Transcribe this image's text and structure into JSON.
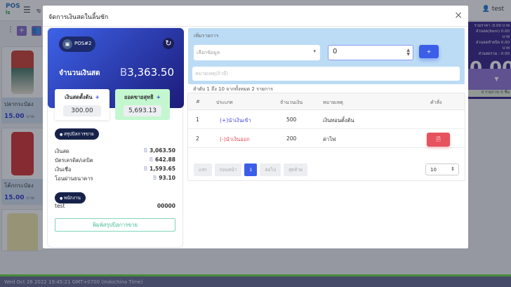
{
  "app": {
    "logo_top": "POS",
    "logo_bottom": "ls",
    "header_partial": "ข",
    "user": "test"
  },
  "products": [
    {
      "name": "ปลากระป๋อง",
      "price": "15.00",
      "unit": "บาท"
    },
    {
      "name": "โค้กกระป๋อง",
      "price": "15.00",
      "unit": "บาท"
    }
  ],
  "summary_panel": {
    "total": "รวมราคา :0.00 บาท",
    "item_discount": "ส่วนลด(Item) 0.00 บาท",
    "bill_discount": "ส่วนลดท้ายบิล 0.00 บาท",
    "total_discount": "ส่วนลดรวม : 0.00",
    "grand_total": "0.00",
    "count": "0 รายการ/ 0 ชิ้น"
  },
  "status_bar": "Wed Oct 26 2022 19:45:21 GMT+0700 (Indochina Time)",
  "modal": {
    "title": "จัดการเงินสดในลิ้นชัก",
    "close": "×",
    "pos_badge": "POS#2",
    "cash_label": "จำนวนเงินสด",
    "currency": "B",
    "cash_value": "3,363.50",
    "opening_label": "เงินสดตั้งต้น",
    "opening_value": "300.00",
    "net_sales_label": "ยอดขายสุทธิ",
    "net_sales_value": "5,693.13",
    "plus": "+",
    "sales_summary_label": "สรุปบิลการขาย",
    "summary_rows": [
      {
        "label": "เงินสด",
        "value": "3,063.50"
      },
      {
        "label": "บัตรเครดิต/เดบิต",
        "value": "642.88"
      },
      {
        "label": "เงินเชื่อ",
        "value": "1,593.65"
      },
      {
        "label": "โอนผ่านธนาคาร",
        "value": "93.10"
      }
    ],
    "employee_label": "พนักงาน",
    "employee_name": "test",
    "employee_code": "00000",
    "print_button": "พิมพ์สรุปบิลการขาย",
    "add_label": "เพิ่มรายการ",
    "select_placeholder": "เลือกข้อมูล",
    "amount_value": "0",
    "add_button": "+",
    "note_placeholder": "หมายเหตุ(ถ้ามี)",
    "page_info": "ลำดับ 1 ถึง 10 จากทั้งหมด 2 รายการ",
    "columns": [
      "#",
      "ประเภท",
      "จำนวนเงิน",
      "หมายเหตุ",
      "คำสั่ง"
    ],
    "rows": [
      {
        "no": "1",
        "type": "(+)นำเงินเข้า",
        "amount": "500",
        "note": "เงินทอนตั้งต้น"
      },
      {
        "no": "2",
        "type": "(-)นำเงินออก",
        "amount": "200",
        "note": "ค่าไฟ"
      }
    ],
    "pager": {
      "first": "แรก",
      "prev": "ก่อนหน้า",
      "current": "1",
      "next": "ต่อไป",
      "last": "สุดท้าย",
      "page_size": "10"
    }
  }
}
